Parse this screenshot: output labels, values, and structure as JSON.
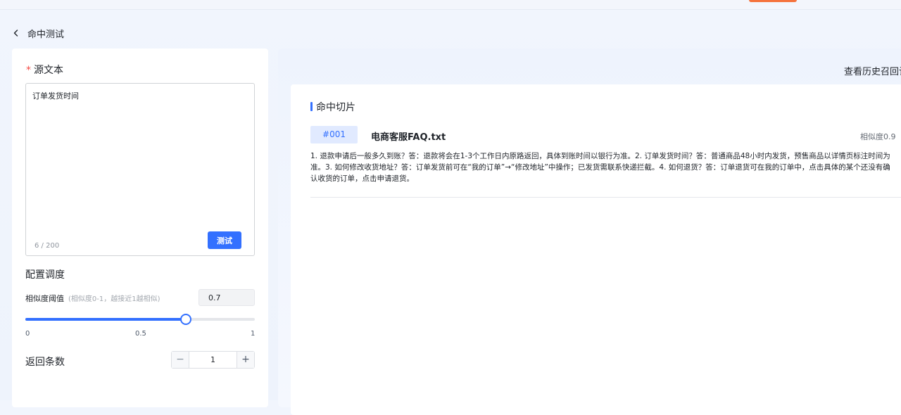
{
  "header": {
    "title": "命中测试"
  },
  "source": {
    "label": "源文本",
    "required_mark": "*",
    "text": "订单发货时间",
    "char_count": "6 / 200",
    "test_button": "测试"
  },
  "config": {
    "label": "配置调度",
    "threshold_label": "相似度阈值",
    "threshold_hint": "(相似度0-1，越接近1越相似)",
    "threshold_value": "0.7",
    "slider": {
      "min": 0,
      "max": 1,
      "value": 0.7,
      "tick_min": "0",
      "tick_mid": "0.5",
      "tick_max": "1"
    },
    "return_label": "返回条数",
    "return_value": "1",
    "minus": "−",
    "plus": "+"
  },
  "results": {
    "history_link": "查看历史召回记录",
    "title": "命中切片",
    "items": [
      {
        "id": "#001",
        "file": "电商客服FAQ.txt",
        "score": "相似度0.9",
        "text": "1. 退款申请后一般多久到账？答：退款将会在1-3个工作日内原路返回，具体到账时间以银行为准。2. 订单发货时间？答：普通商品48小时内发货，预售商品以详情页标注时间为准。3. 如何修改收货地址？答：订单发货前可在“我的订单”→“修改地址”中操作；已发货需联系快递拦截。4. 如何退货？答：订单退货可在我的订单中，点击具体的某个还没有确认收货的订单，点击申请退货。"
      }
    ]
  },
  "colors": {
    "accent": "#3370ff",
    "required": "#f54a45",
    "top_accent": "#f5733d"
  }
}
